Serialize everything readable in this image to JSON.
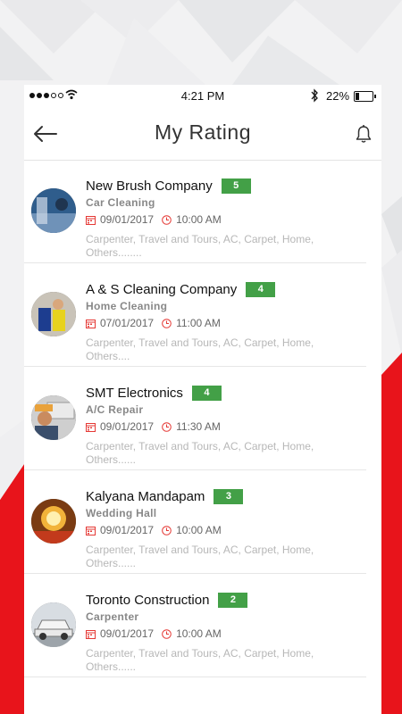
{
  "status_bar": {
    "time": "4:21 PM",
    "battery_percent": "22%",
    "battery_level": 0.22,
    "icons": [
      "signal-dots",
      "wifi-icon",
      "bluetooth-icon",
      "battery-icon"
    ]
  },
  "header": {
    "title": "My Rating",
    "back_icon": "back-arrow-icon",
    "notification_icon": "bell-icon"
  },
  "items": [
    {
      "name": "New Brush Company",
      "rating": "5",
      "category": "Car Cleaning",
      "date": "09/01/2017",
      "time": "10:00 AM",
      "description": "Carpenter, Travel and Tours, AC, Carpet, Home, Others........"
    },
    {
      "name": "A & S Cleaning Company",
      "rating": "4",
      "category": "Home Cleaning",
      "date": "07/01/2017",
      "time": "11:00 AM",
      "description": "Carpenter, Travel and Tours, AC, Carpet, Home, Others...."
    },
    {
      "name": "SMT Electronics",
      "rating": "4",
      "category": "A/C Repair",
      "date": "09/01/2017",
      "time": "11:30 AM",
      "description": "Carpenter, Travel and Tours, AC, Carpet, Home, Others......"
    },
    {
      "name": "Kalyana Mandapam",
      "rating": "3",
      "category": "Wedding Hall",
      "date": "09/01/2017",
      "time": "10:00 AM",
      "description": "Carpenter, Travel and Tours, AC, Carpet, Home, Others......"
    },
    {
      "name": "Toronto Construction",
      "rating": "2",
      "category": "Carpenter",
      "date": "09/01/2017",
      "time": "10:00 AM",
      "description": "Carpenter, Travel and Tours, AC, Carpet, Home, Others......"
    }
  ],
  "colors": {
    "rating_badge": "#43a047",
    "icon_accent": "#e53935",
    "background_red": "#e8141b"
  }
}
